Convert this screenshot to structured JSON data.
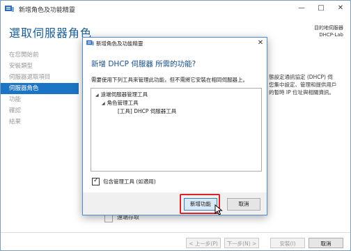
{
  "window": {
    "title": "新增角色及功能精靈",
    "minimize": "—",
    "maximize": "□",
    "close": "✕"
  },
  "page": {
    "title": "選取伺服器角色",
    "dest_label": "目的地伺服器",
    "dest_server": "DHCP-Lab"
  },
  "nav": {
    "items": [
      {
        "label": "在您開始前"
      },
      {
        "label": "安裝類型"
      },
      {
        "label": "伺服器選取項目"
      },
      {
        "label": "伺服器角色"
      },
      {
        "label": "功能"
      },
      {
        "label": "確認"
      },
      {
        "label": "結果"
      }
    ],
    "active_index": 3
  },
  "side_description": {
    "line1": "態設定通訊協定 (DHCP) 伺",
    "line2": "您集中設定、管理和提供用戶",
    "line3": "的暫時 IP 位址與相關資訊。"
  },
  "background_row": {
    "label": "遠端存取"
  },
  "buttons": {
    "prev": "< 上一步(P)",
    "next": "下一步(N) >",
    "install": "安裝(I)",
    "cancel": "取消"
  },
  "dialog": {
    "title": "新增角色及功能精靈",
    "close": "✕",
    "heading": "新增 DHCP 伺服器 所需的功能?",
    "description": "需要使用下列工具來管理此功能，但不需將它安裝在相同伺服器上。",
    "tree": [
      {
        "label": "遠端伺服器管理工具"
      },
      {
        "label": "角色管理工具"
      },
      {
        "label": "[工具] DHCP 伺服器工具"
      }
    ],
    "include_tools_label": "包含管理工具 (如適用)",
    "include_tools_checked": true,
    "add_button": "新增功能",
    "cancel_button": "取消"
  },
  "colors": {
    "title_blue": "#1a5d95",
    "nav_active": "#1c74c5",
    "dialog_border": "#4c8bd0",
    "highlight_red": "#d9232b"
  }
}
